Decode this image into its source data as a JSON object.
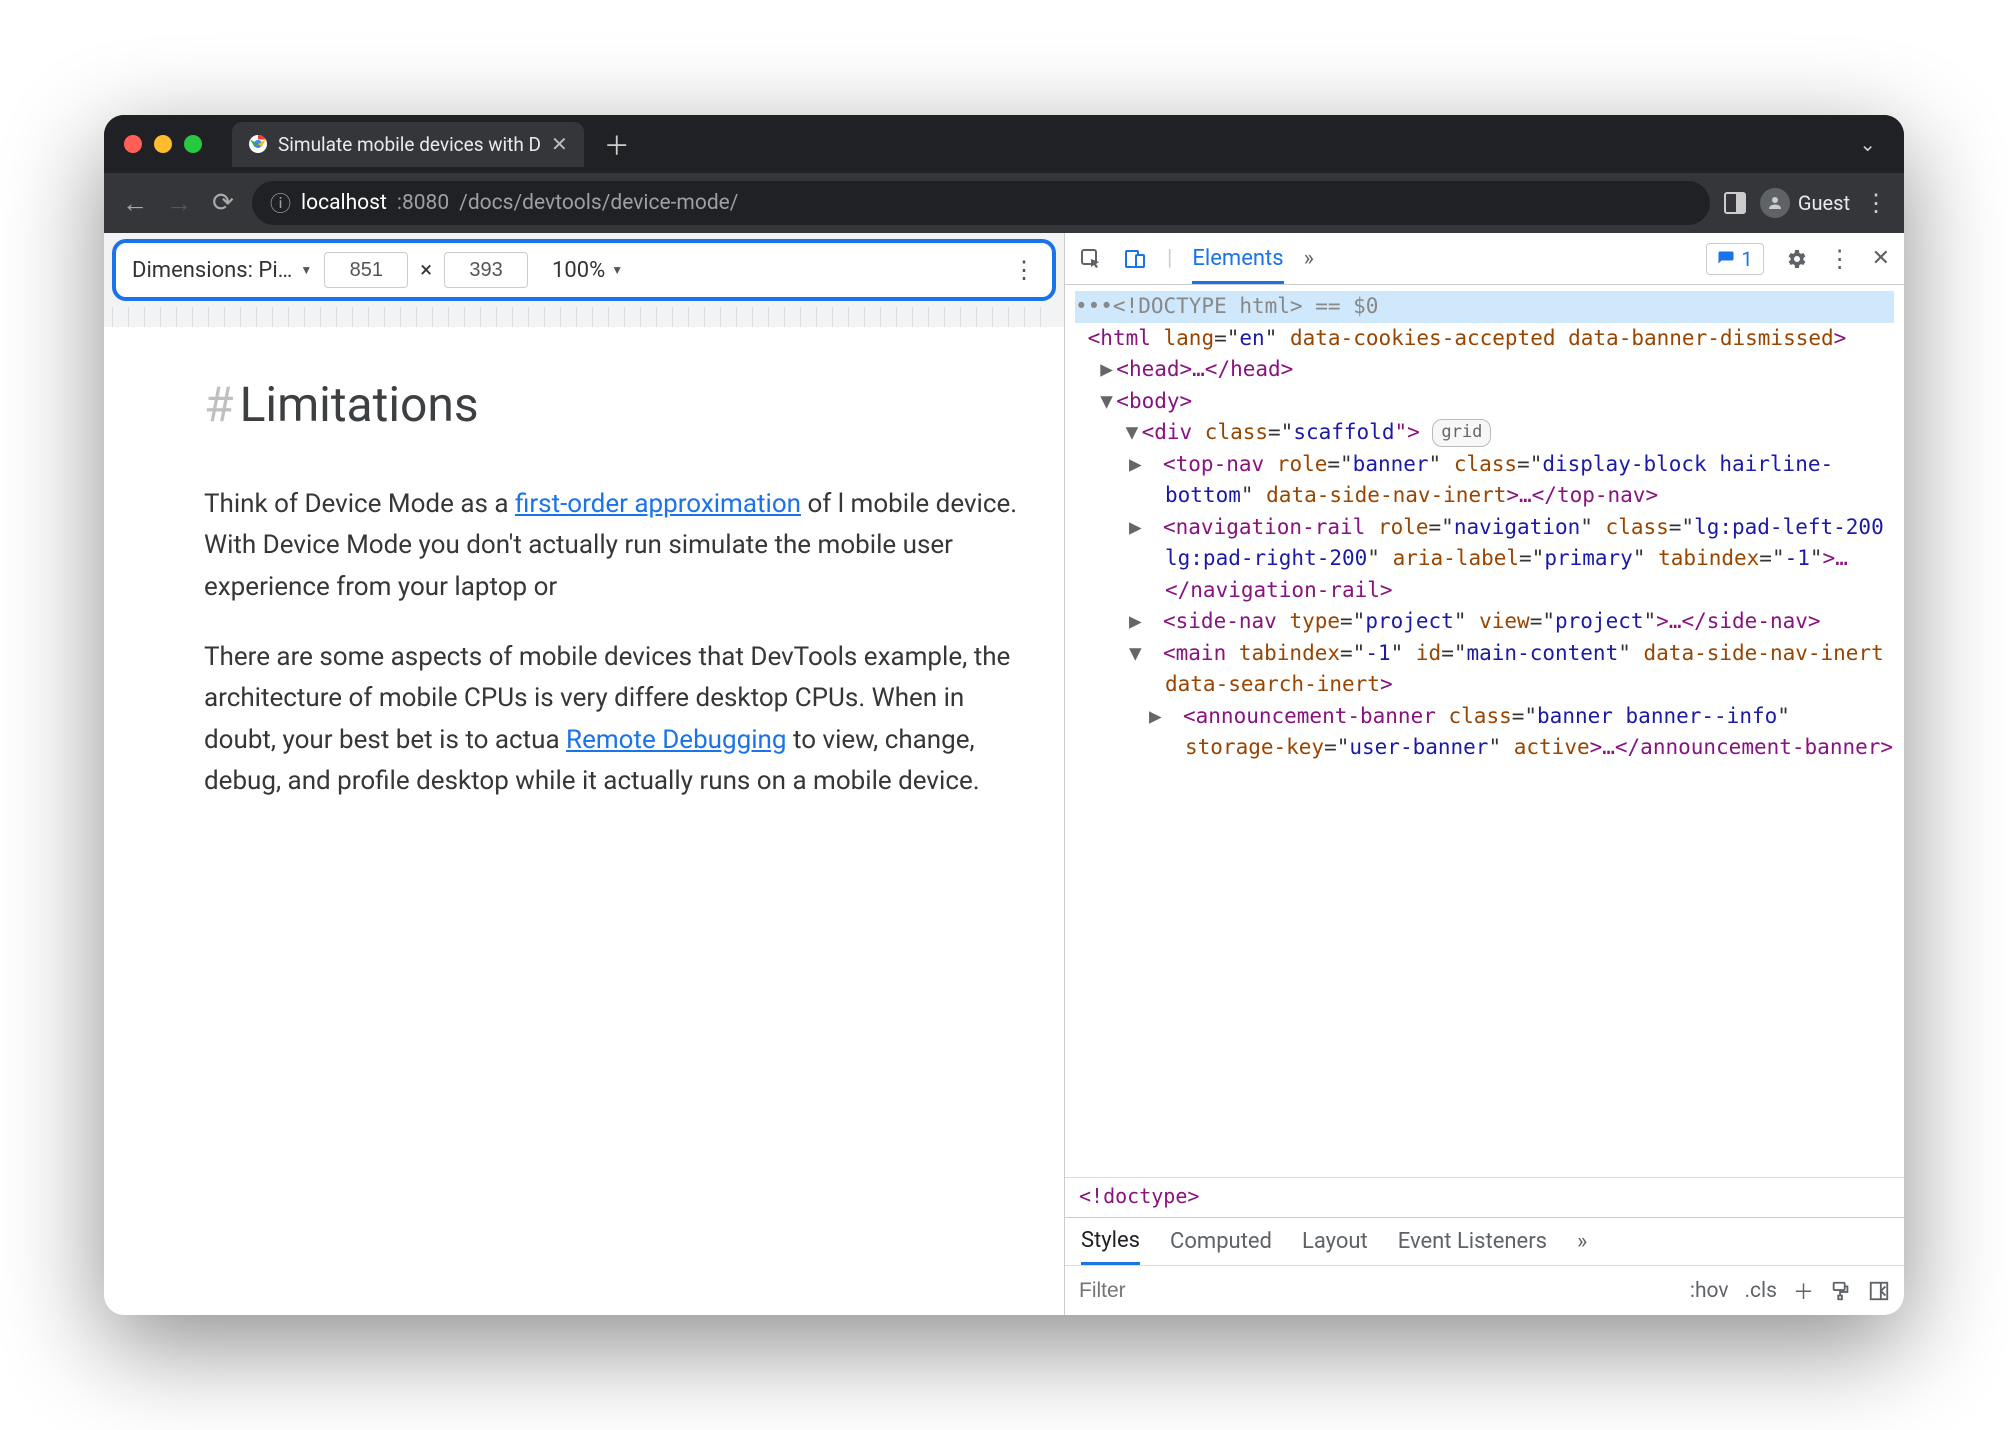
{
  "browser": {
    "tab_title": "Simulate mobile devices with D",
    "url_host": "localhost",
    "url_port": ":8080",
    "url_path": "/docs/devtools/device-mode/",
    "guest_label": "Guest"
  },
  "device_toolbar": {
    "dimensions_label": "Dimensions: Pi…",
    "width": "851",
    "times": "×",
    "height": "393",
    "zoom": "100%"
  },
  "page": {
    "heading": "Limitations",
    "p1_pre": "Think of Device Mode as a ",
    "p1_link": "first-order approximation",
    "p1_post": " of l mobile device. With Device Mode you don't actually run simulate the mobile user experience from your laptop or",
    "p2_pre": "There are some aspects of mobile devices that DevTools example, the architecture of mobile CPUs is very differe desktop CPUs. When in doubt, your best bet is to actua ",
    "p2_link": "Remote Debugging",
    "p2_post": " to view, change, debug, and profile desktop while it actually runs on a mobile device."
  },
  "devtools": {
    "tabs": {
      "elements": "Elements"
    },
    "issues_count": "1",
    "dom": {
      "l0": "•••<!DOCTYPE html> == $0",
      "l1a": "<html ",
      "l1b": "lang",
      "l1c": "=\"",
      "l1d": "en",
      "l1e": "\" ",
      "l1f": "data-cookies-accepted data-banner-dismissed",
      "l1g": ">",
      "l2": "<head>…</head>",
      "l3": "<body>",
      "l4a": "<div ",
      "l4b": "class",
      "l4c": "=\"",
      "l4d": "scaffold",
      "l4e": "\">",
      "l4pill": "grid",
      "l5": "<top-nav role=\"banner\" class=\"display-block hairline-bottom\" data-side-nav-inert>…</top-nav>",
      "l6": "<navigation-rail role=\"navigation\" class=\"lg:pad-left-200 lg:pad-right-200\" aria-label=\"primary\" tabindex=\"-1\">…</navigation-rail>",
      "l7": "<side-nav type=\"project\" view=\"project\">…</side-nav>",
      "l8": "<main tabindex=\"-1\" id=\"main-content\" data-side-nav-inert data-search-inert>",
      "l9": "<announcement-banner class=\"banner banner--info\" storage-key=\"user-banner\" active>…</announcement-banner>"
    },
    "crumb": "<!doctype>",
    "subtabs": {
      "styles": "Styles",
      "computed": "Computed",
      "layout": "Layout",
      "eventlisteners": "Event Listeners"
    },
    "filter_placeholder": "Filter",
    "hov": ":hov",
    "cls": ".cls"
  }
}
